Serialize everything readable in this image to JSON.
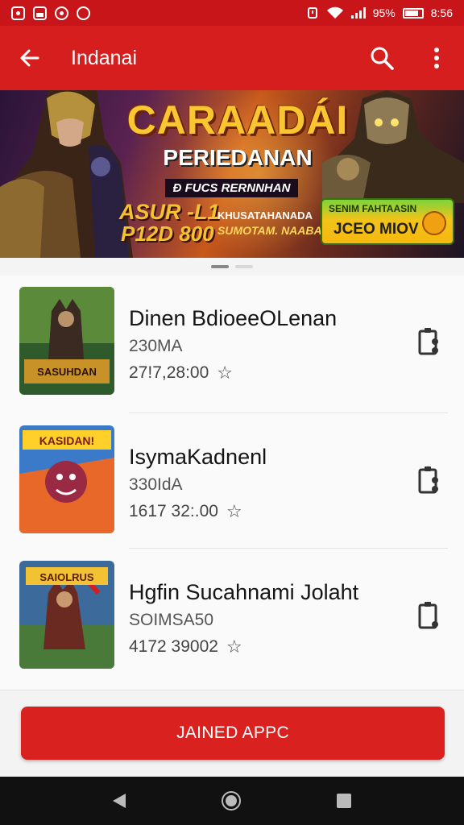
{
  "status_bar": {
    "right_text": "95%",
    "time": "8:56"
  },
  "app_bar": {
    "title": "Indanai"
  },
  "banner": {
    "title": "CARAADÁI",
    "subtitle": "PERIEDANAN",
    "tagline": "Ð FUCS RERNNHAN",
    "promo_line1": "ASUR -L1",
    "promo_line2": "P12D 800",
    "small_line1": "KHUSATAHANADA",
    "small_line2": "SUMOTAM. NAABA",
    "cta_top": "SENIM FAHTAASIN",
    "cta_main": "JCEO MIOV"
  },
  "pager": {
    "count": 2,
    "active": 0
  },
  "games": [
    {
      "name": "Dinen BdioeeOLenan",
      "size": "230MA",
      "rating": "27!7,28:00"
    },
    {
      "name": "IsymaKadnenl",
      "size": "330IdA",
      "rating": "1617 32:.00"
    },
    {
      "name": "Hgfin Sucahnami Jolaht",
      "size": "SOIMSA50",
      "rating": "4172 39002"
    }
  ],
  "thumb_texts": [
    "SASUHDAN",
    "KASIDAN!",
    "SAIOLRUS"
  ],
  "primary_button": {
    "label": "JAINED APPC"
  },
  "colors": {
    "accent": "#d71e1e",
    "status_bar": "#c8151a",
    "button": "#d92120"
  },
  "icons": [
    "back-arrow-icon",
    "search-icon",
    "more-vert-icon",
    "clipboard-icon",
    "star-icon"
  ]
}
